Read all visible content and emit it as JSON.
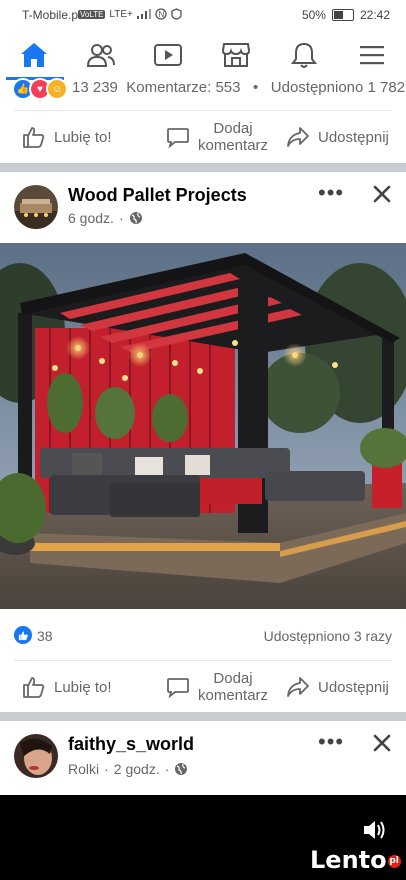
{
  "status_bar": {
    "carrier": "T-Mobile.pl",
    "volte": "VoLTE",
    "lte": "LTE+",
    "battery": "50%",
    "time": "22:42"
  },
  "nav": {
    "items": [
      "home-icon",
      "friends-icon",
      "video-icon",
      "marketplace-icon",
      "notifications-icon",
      "menu-icon"
    ],
    "active_color": "#1877f2"
  },
  "prev_post": {
    "reactions_count": "13 239",
    "comments": "Komentarze: 553",
    "sep": "•",
    "shares": "Udostępniono 1 782 r"
  },
  "actions": {
    "like": "Lubię to!",
    "comment_line1": "Dodaj",
    "comment_line2": "komentarz",
    "share": "Udostępnij"
  },
  "post1": {
    "name": "Wood Pallet Projects",
    "time": "6 godz.",
    "dot": "·",
    "likes": "38",
    "shares": "Udostępniono 3 razy"
  },
  "post2": {
    "name": "faithy_s_world",
    "type": "Rolki",
    "dot": "·",
    "time": "2 godz."
  },
  "video_overlay": {
    "brand": "Lento",
    "brand_suffix": "pl"
  },
  "icons": {
    "more": "•••",
    "close": "close-icon",
    "globe": "globe-icon",
    "volume": "volume-icon"
  }
}
